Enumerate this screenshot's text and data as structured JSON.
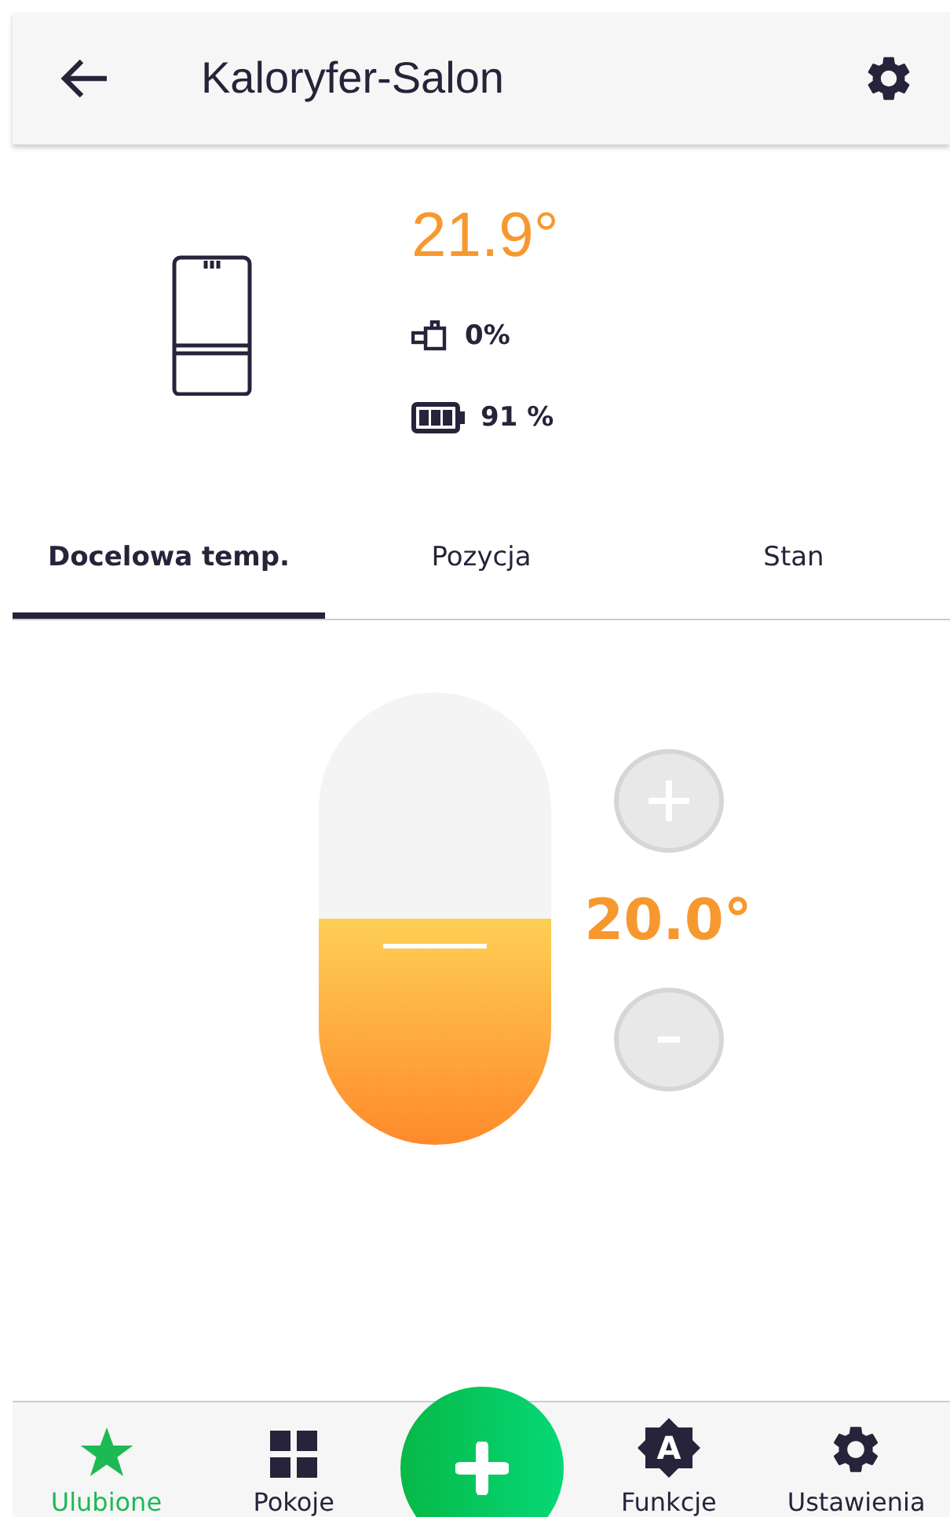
{
  "header": {
    "title": "Kaloryfer-Salon"
  },
  "status": {
    "temperature": "21.9°",
    "valve": "0%",
    "battery": "91 %"
  },
  "tabs": [
    {
      "label": "Docelowa temp.",
      "selected": true
    },
    {
      "label": "Pozycja",
      "selected": false
    },
    {
      "label": "Stan",
      "selected": false
    }
  ],
  "target": {
    "level": 0.5,
    "reading": "20.0°"
  },
  "nav": [
    {
      "kind": "star",
      "label": "Ulubione",
      "selected": true
    },
    {
      "kind": "grid",
      "label": "Pokoje",
      "selected": false
    },
    {
      "kind": "fab"
    },
    {
      "kind": "badge",
      "label": "Funkcje",
      "letter": "A",
      "selected": false
    },
    {
      "kind": "gear",
      "label": "Ustawienia",
      "selected": false
    }
  ]
}
